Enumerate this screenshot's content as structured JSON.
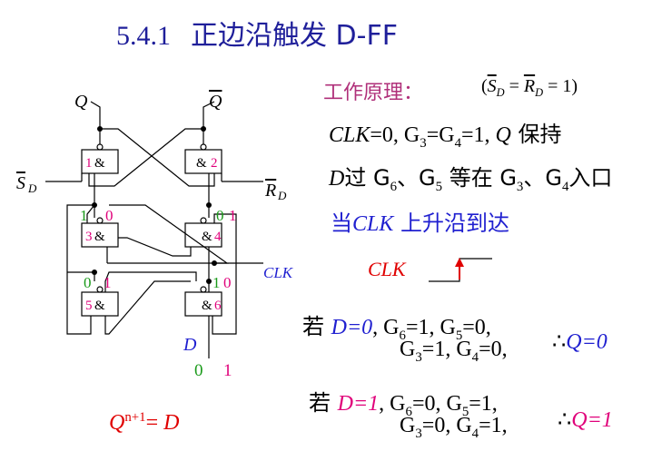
{
  "title": {
    "number": "5.4.1",
    "text": "正边沿触发 D-FF"
  },
  "principle": {
    "label": "工作原理：",
    "condition_s": "S",
    "condition_r": "R",
    "condition_sub": "D",
    "condition_eq": "= 1"
  },
  "line1": {
    "clk": "CLK",
    "rest1": "=0, G",
    "s3": "3",
    "eq": "=G",
    "s4": "4",
    "rest2": "=1, ",
    "q": "Q",
    "hold": " 保持"
  },
  "line2": {
    "d": "D",
    "pass": "过 G",
    "s6": "6",
    "sep": "、G",
    "s5": "5",
    "wait": " 等在 G",
    "s3b": "3",
    "sep2": "、G",
    "s4b": "4",
    "entry": "入口"
  },
  "line3": {
    "when": "当",
    "clk": "CLK",
    "rise": " 上升沿到达"
  },
  "clk_waveform_label": "CLK",
  "caseA": {
    "ruo": "若 ",
    "cond": "D=0",
    "g6": ", G",
    "s6": "6",
    "v6": "=1, G",
    "s5": "5",
    "v5": "=0,",
    "g3": "G",
    "s3": "3",
    "v3": "=1, G",
    "s4": "4",
    "v4": "=0,",
    "therefore": "∴",
    "result": "Q=0"
  },
  "caseB": {
    "ruo": "若 ",
    "cond": "D=1",
    "g6": ", G",
    "s6": "6",
    "v6": "=0, G",
    "s5": "5",
    "v5": "=1,",
    "g3": "G",
    "s3": "3",
    "v3": "=0, G",
    "s4": "4",
    "v4": "=1,",
    "therefore": "∴",
    "result": "Q=1"
  },
  "formula": {
    "q": "Q",
    "sup": "n+1",
    "eq": "= ",
    "d": "D"
  },
  "circuit": {
    "q_label": "Q",
    "qbar_label": "Q",
    "sd_label": "S",
    "rd_label": "R",
    "sub_d": "D",
    "clk_label": "CLK",
    "d_label": "D",
    "g1": {
      "num": "1",
      "sym": "&"
    },
    "g2": {
      "num": "2",
      "sym": "&"
    },
    "g3": {
      "num": "3",
      "sym": "&"
    },
    "g4": {
      "num": "4",
      "sym": "&"
    },
    "g5": {
      "num": "5",
      "sym": "&"
    },
    "g6": {
      "num": "6",
      "sym": "&"
    },
    "g3_levels": [
      "1",
      "0"
    ],
    "g4_levels": [
      "0",
      "1"
    ],
    "g5_levels": [
      "0",
      "1"
    ],
    "g6_levels": [
      "1",
      "0"
    ],
    "d_levels": [
      "0",
      "1"
    ]
  },
  "colors": {
    "title": "#1f1f9a",
    "blue": "#1f1fd0",
    "magenta": "#e0007a",
    "green": "#1a9a1a",
    "red": "#e00000",
    "principle": "#b0307a"
  }
}
